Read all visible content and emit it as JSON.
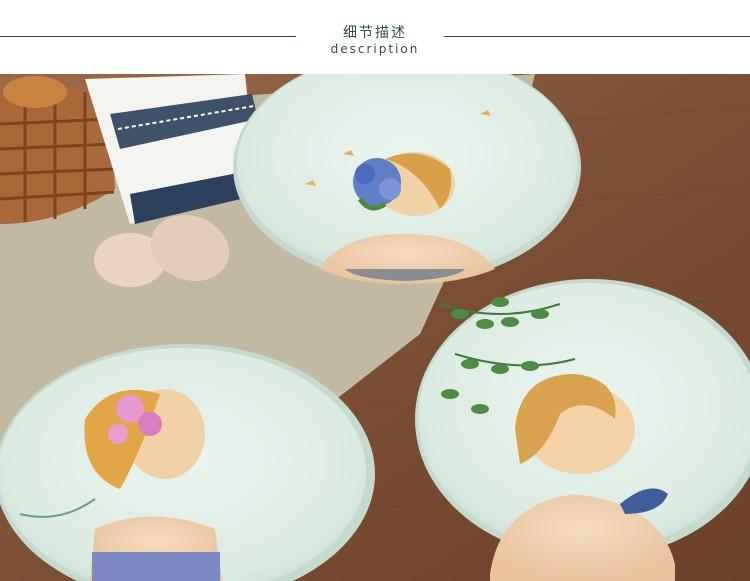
{
  "header": {
    "title_cn": "细节描述",
    "title_en": "description"
  },
  "colors": {
    "rule": "#2f4a52",
    "table_wood": "#8a5a3c",
    "plate": "#dfeee4"
  }
}
